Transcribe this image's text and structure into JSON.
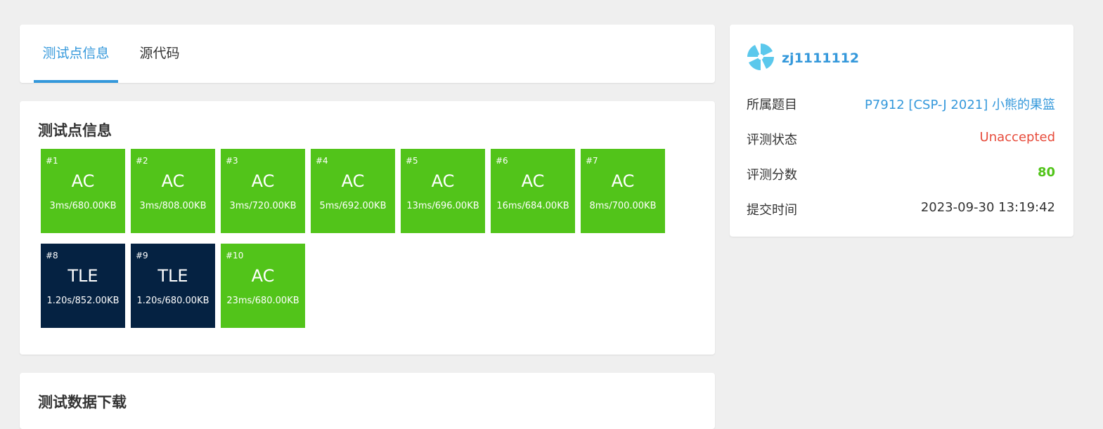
{
  "tabs": [
    {
      "label": "测试点信息",
      "active": true
    },
    {
      "label": "源代码",
      "active": false
    }
  ],
  "test_section": {
    "title": "测试点信息",
    "cases": [
      {
        "num": "#1",
        "result": "AC",
        "info": "3ms/680.00KB"
      },
      {
        "num": "#2",
        "result": "AC",
        "info": "3ms/808.00KB"
      },
      {
        "num": "#3",
        "result": "AC",
        "info": "3ms/720.00KB"
      },
      {
        "num": "#4",
        "result": "AC",
        "info": "5ms/692.00KB"
      },
      {
        "num": "#5",
        "result": "AC",
        "info": "13ms/696.00KB"
      },
      {
        "num": "#6",
        "result": "AC",
        "info": "16ms/684.00KB"
      },
      {
        "num": "#7",
        "result": "AC",
        "info": "8ms/700.00KB"
      },
      {
        "num": "#8",
        "result": "TLE",
        "info": "1.20s/852.00KB"
      },
      {
        "num": "#9",
        "result": "TLE",
        "info": "1.20s/680.00KB"
      },
      {
        "num": "#10",
        "result": "AC",
        "info": "23ms/680.00KB"
      }
    ]
  },
  "download_section": {
    "title": "测试数据下载"
  },
  "submission": {
    "username": "zj1111112",
    "problem_label": "所属题目",
    "problem_value": "P7912 [CSP-J 2021] 小熊的果篮",
    "status_label": "评测状态",
    "status_value": "Unaccepted",
    "score_label": "评测分数",
    "score_value": "80",
    "time_label": "提交时间",
    "time_value": "2023-09-30 13:19:42"
  },
  "colors": {
    "accent": "#3498db",
    "ac": "#52c41a",
    "tle": "#052242",
    "unaccepted": "#e74c3c",
    "score": "#52c41a",
    "avatar": "#5bc8ec"
  },
  "icons": {
    "avatar": "pinwheel-avatar-icon"
  }
}
